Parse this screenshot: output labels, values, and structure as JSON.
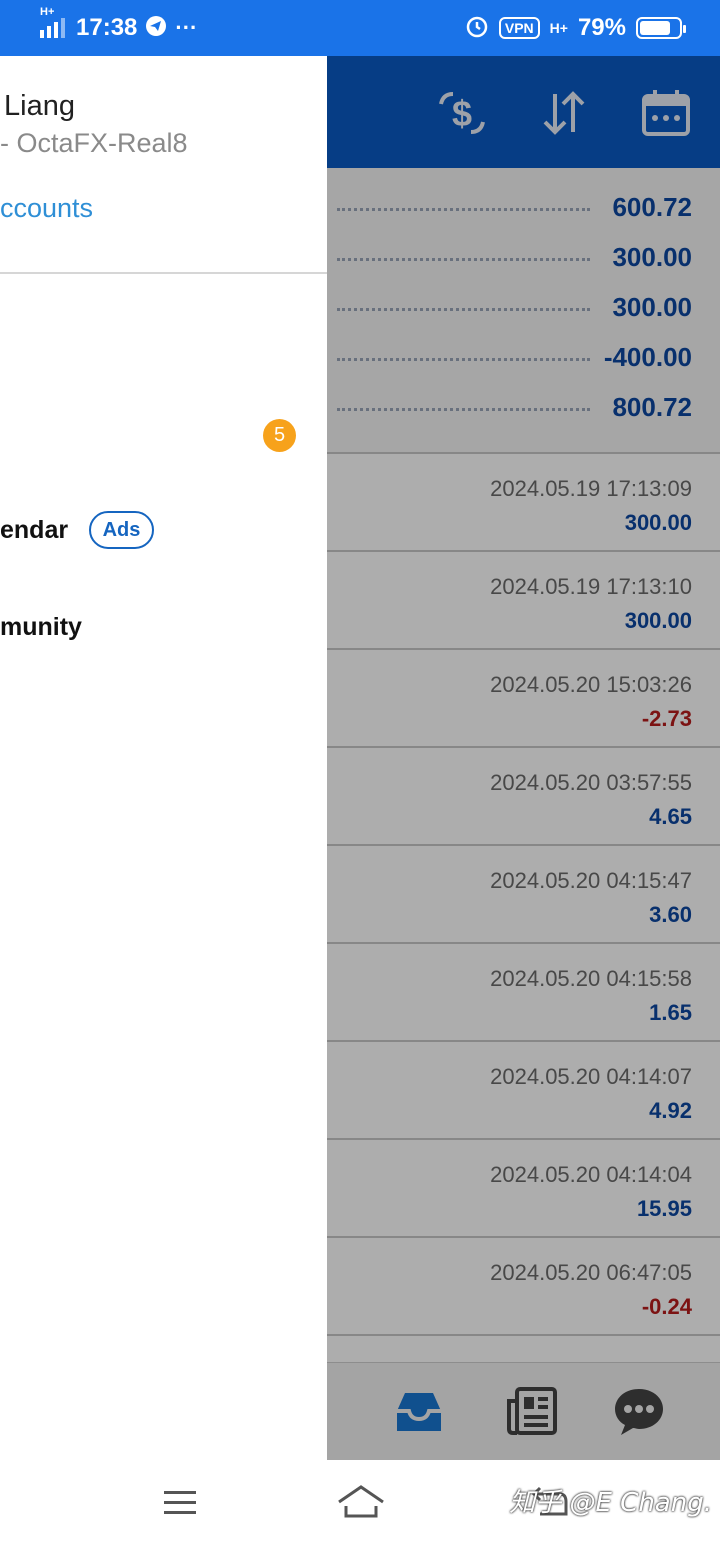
{
  "status_bar": {
    "signal_type": "H+",
    "time": "17:38",
    "more_glyph": "···",
    "vpn_label": "VPN",
    "network_type": "H+",
    "battery_pct": "79%",
    "battery_level": 0.79,
    "icons": [
      "signal-icon",
      "telegram-icon",
      "alarm-icon",
      "battery-icon"
    ]
  },
  "drawer": {
    "account_name": "Liang",
    "server": "- OctaFX-Real8",
    "accounts_link": "ccounts",
    "badge_count": "5",
    "items": [
      {
        "label": "endar",
        "ads": "Ads"
      },
      {
        "label": "munity"
      }
    ]
  },
  "toolbar": {
    "icons": [
      "currency-exchange-icon",
      "sort-icon",
      "calendar-icon"
    ],
    "color": "#0a5bc4"
  },
  "summary": {
    "rows": [
      "600.72",
      "300.00",
      "300.00",
      "-400.00",
      "800.72"
    ]
  },
  "deals": [
    {
      "time": "2024.05.19 17:13:09",
      "profit": "300.00",
      "negative": false
    },
    {
      "time": "2024.05.19 17:13:10",
      "profit": "300.00",
      "negative": false
    },
    {
      "time": "2024.05.20 15:03:26",
      "profit": "-2.73",
      "negative": true
    },
    {
      "time": "2024.05.20 03:57:55",
      "profit": "4.65",
      "negative": false
    },
    {
      "time": "2024.05.20 04:15:47",
      "profit": "3.60",
      "negative": false
    },
    {
      "time": "2024.05.20 04:15:58",
      "profit": "1.65",
      "negative": false
    },
    {
      "time": "2024.05.20 04:14:07",
      "profit": "4.92",
      "negative": false
    },
    {
      "time": "2024.05.20 04:14:04",
      "profit": "15.95",
      "negative": false
    },
    {
      "time": "2024.05.20 06:47:05",
      "profit": "-0.24",
      "negative": true
    }
  ],
  "bottom_tabs": [
    "inbox-icon",
    "news-icon",
    "chat-icon"
  ],
  "nav": {
    "icons": [
      "menu-icon",
      "home-icon",
      "back-icon"
    ],
    "watermark": "知乎 @E Chang."
  },
  "colors": {
    "status_bar": "#1a73e8",
    "positive": "#0d47a1",
    "negative": "#b71c1c",
    "link": "#2f8fd6",
    "badge": "#f7a21b"
  }
}
